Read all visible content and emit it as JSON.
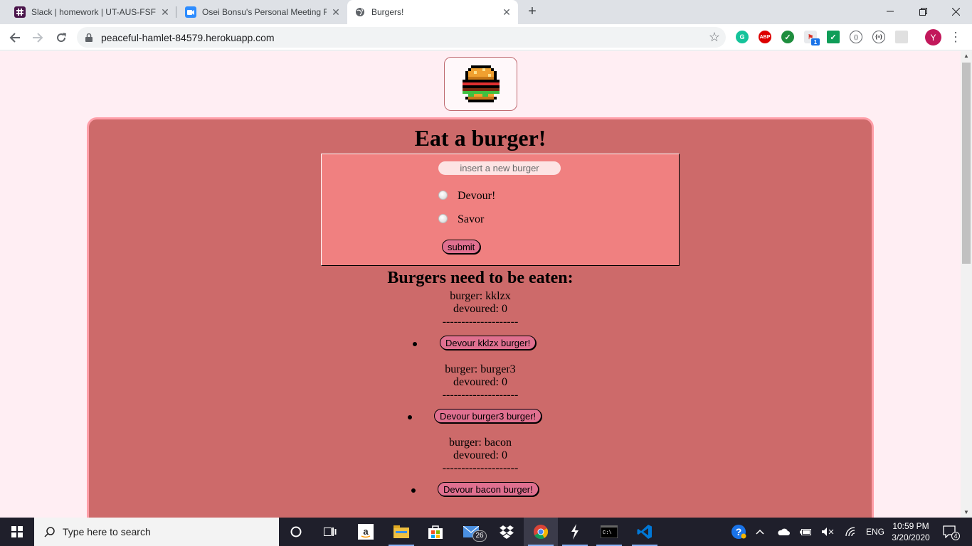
{
  "browser": {
    "tabs": [
      {
        "title": "Slack | homework | UT-AUS-FSF-P",
        "icon": "slack-icon"
      },
      {
        "title": "Osei Bonsu's Personal Meeting R",
        "icon": "zoom-icon"
      },
      {
        "title": "Burgers!",
        "icon": "globe-icon"
      }
    ],
    "new_tab": "+",
    "url": "peaceful-hamlet-84579.herokuapp.com",
    "avatar_letter": "Y",
    "extension_badge": "1"
  },
  "page": {
    "headline": "Eat a burger!",
    "form": {
      "placeholder": "insert a new burger",
      "options": [
        "Devour!",
        "Savor"
      ],
      "submit_label": "submit"
    },
    "list_title": "Burgers need to be eaten:",
    "burgers": [
      {
        "name_line": "burger: kklzx",
        "devoured_line": "devoured: 0",
        "divider": "--------------------",
        "button": "Devour kklzx burger!"
      },
      {
        "name_line": "burger: burger3",
        "devoured_line": "devoured: 0",
        "divider": "--------------------",
        "button": "Devour burger3 burger!"
      },
      {
        "name_line": "burger: bacon",
        "devoured_line": "devoured: 0",
        "divider": "--------------------",
        "button": "Devour bacon burger!"
      }
    ],
    "colors": {
      "background": "#ffeef3",
      "panel": "#cd6a6a",
      "panel_border": "#ff9ea8",
      "form": "#f08080",
      "button": "#e07090"
    }
  },
  "taskbar": {
    "search_placeholder": "Type here to search",
    "mail_badge": "26",
    "language": "ENG",
    "time": "10:59 PM",
    "date": "3/20/2020",
    "notifications": "4"
  }
}
